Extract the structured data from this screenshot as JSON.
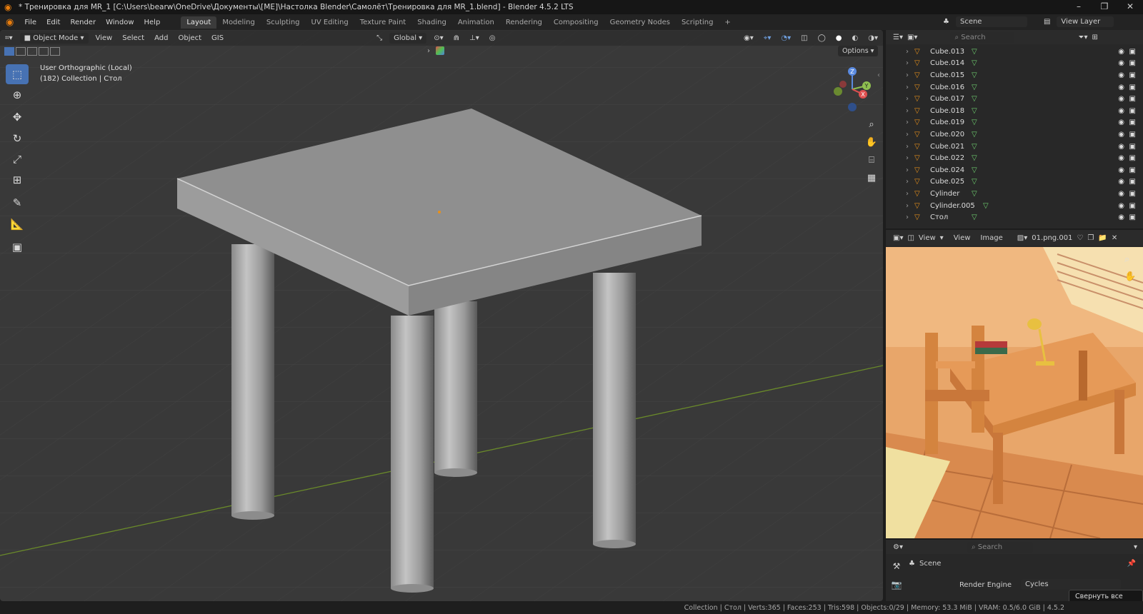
{
  "window": {
    "title": "* Тренировка для MR_1 [C:\\Users\\bearw\\OneDrive\\Документы\\[ME]\\Настолка Blender\\Самолёт\\Тренировка для MR_1.blend] - Blender 4.5.2 LTS"
  },
  "menu": [
    "File",
    "Edit",
    "Render",
    "Window",
    "Help"
  ],
  "workspaces": [
    "Layout",
    "Modeling",
    "Sculpting",
    "UV Editing",
    "Texture Paint",
    "Shading",
    "Animation",
    "Rendering",
    "Compositing",
    "Geometry Nodes",
    "Scripting"
  ],
  "scene_selector": {
    "label": "Scene",
    "view_layer": "View Layer"
  },
  "viewport": {
    "mode": "Object Mode",
    "menus": [
      "View",
      "Select",
      "Add",
      "Object",
      "GIS"
    ],
    "orientation": "Global",
    "options": "Options",
    "view_name": "User Orthographic (Local)",
    "collection_info": "(182) Collection | Стол",
    "gizmo": {
      "z": "Z",
      "y": "Y",
      "x": "X"
    }
  },
  "outliner": {
    "search_placeholder": "Search",
    "items": [
      {
        "name": "Cube.013"
      },
      {
        "name": "Cube.014"
      },
      {
        "name": "Cube.015"
      },
      {
        "name": "Cube.016"
      },
      {
        "name": "Cube.017"
      },
      {
        "name": "Cube.018"
      },
      {
        "name": "Cube.019"
      },
      {
        "name": "Cube.020"
      },
      {
        "name": "Cube.021"
      },
      {
        "name": "Cube.022"
      },
      {
        "name": "Cube.024"
      },
      {
        "name": "Cube.025"
      },
      {
        "name": "Cylinder"
      },
      {
        "name": "Cylinder.005"
      },
      {
        "name": "Стол"
      }
    ]
  },
  "image_editor": {
    "menus": [
      "View",
      "View",
      "Image"
    ],
    "image_name": "01.png.001"
  },
  "properties": {
    "search_placeholder": "Search",
    "scene_label": "Scene",
    "render_engine_label": "Render Engine",
    "render_engine_value": "Cycles"
  },
  "tooltip": "Свернуть все окна",
  "status": "Collection | Стол | Verts:365 | Faces:253 | Tris:598 | Objects:0/29 | Memory: 53.3 MiB | VRAM: 0.5/6.0 GiB | 4.5.2",
  "colors": {
    "accent": "#4772b3",
    "blender_orange": "#e87d0d",
    "mesh_green": "#6fd06f"
  }
}
